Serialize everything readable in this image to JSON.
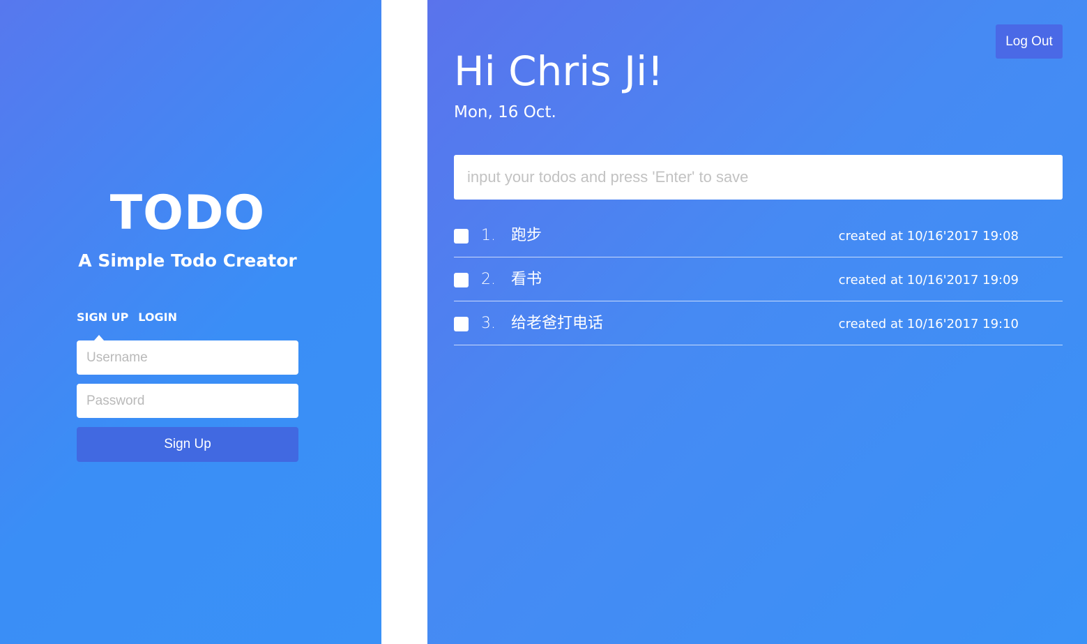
{
  "auth": {
    "title": "TODO",
    "subtitle": "A Simple Todo Creator",
    "tabs": [
      {
        "label": "SIGN UP",
        "active": true
      },
      {
        "label": "LOGIN",
        "active": false
      }
    ],
    "username_placeholder": "Username",
    "password_placeholder": "Password",
    "submit_label": "Sign Up"
  },
  "todo_app": {
    "logout_label": "Log Out",
    "greeting": "Hi Chris Ji!",
    "date": "Mon, 16 Oct.",
    "input_placeholder": "input your todos and press 'Enter' to save",
    "todos": [
      {
        "index": "1.",
        "text": "跑步",
        "created": "created at 10/16'2017 19:08",
        "done": false
      },
      {
        "index": "2.",
        "text": "看书",
        "created": "created at 10/16'2017 19:09",
        "done": false
      },
      {
        "index": "3.",
        "text": "给老爸打电话",
        "created": "created at 10/16'2017 19:10",
        "done": false
      }
    ]
  },
  "colors": {
    "panel_gradient_start": "#5778ee",
    "panel_gradient_end": "#3991f7",
    "button_accent": "#4169e1",
    "text": "#ffffff"
  }
}
